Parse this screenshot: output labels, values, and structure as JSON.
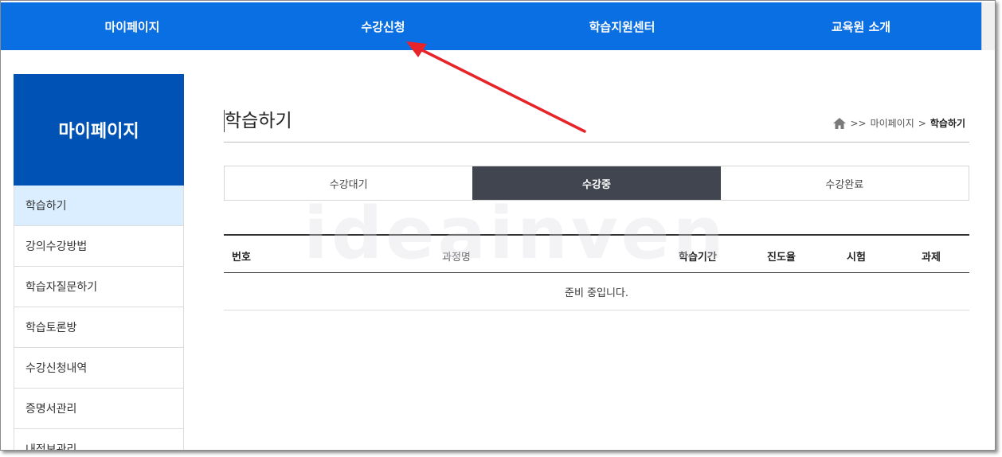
{
  "topnav": {
    "items": [
      "마이페이지",
      "수강신청",
      "학습지원센터",
      "교육원 소개"
    ]
  },
  "sidebar": {
    "title": "마이페이지",
    "items": [
      "학습하기",
      "강의수강방법",
      "학습자질문하기",
      "학습토론방",
      "수강신청내역",
      "증명서관리",
      "내정보관리"
    ]
  },
  "content": {
    "title": "학습하기",
    "breadcrumb": {
      "sep1": ">>",
      "level1": "마이페이지",
      "sep2": ">",
      "current": "학습하기"
    },
    "tabs": [
      "수강대기",
      "수강중",
      "수강완료"
    ],
    "table": {
      "headers": [
        "번호",
        "과정명",
        "학습기간",
        "진도율",
        "시험",
        "과제"
      ],
      "empty_message": "준비 중입니다."
    }
  },
  "watermark": "ideainven",
  "colors": {
    "nav_blue": "#0a6fe3",
    "sidebar_blue": "#0052b4",
    "active_tab": "#404550",
    "arrow_red": "#e8232a"
  }
}
